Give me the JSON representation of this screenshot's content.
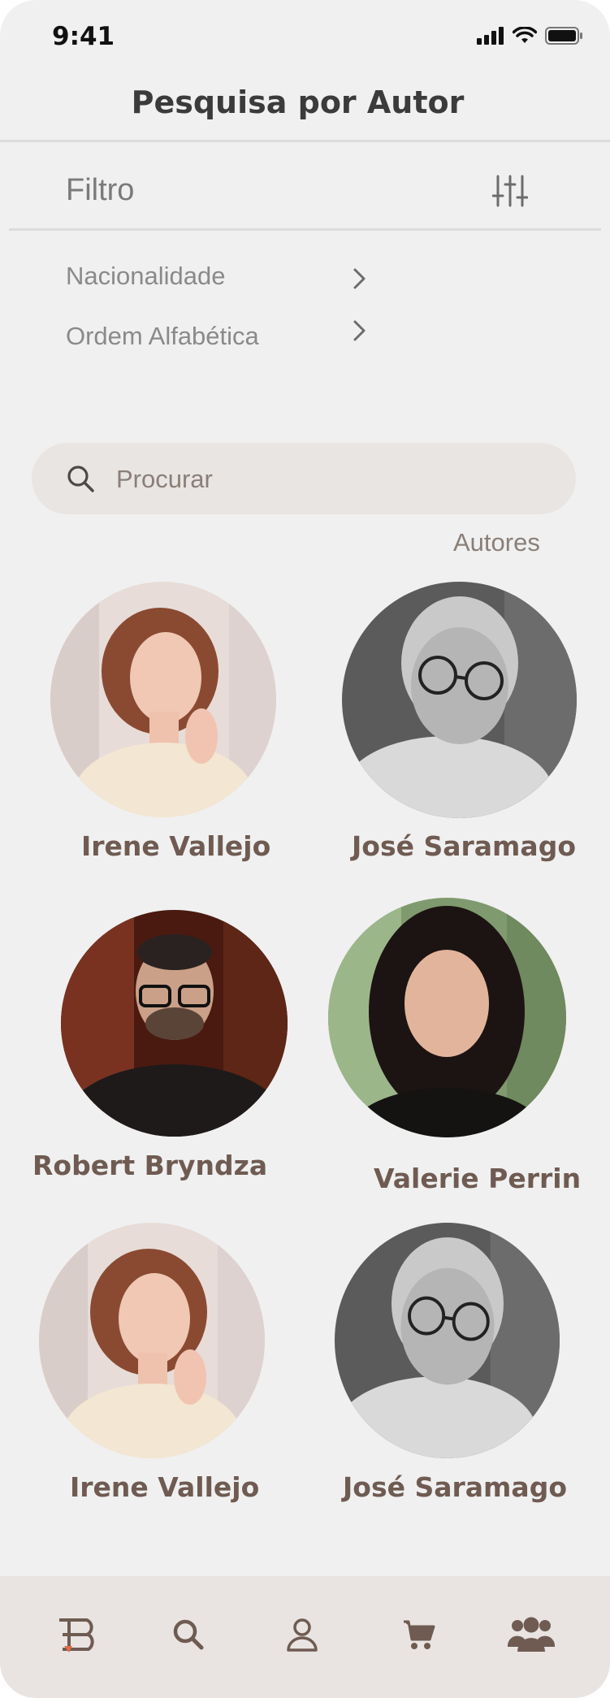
{
  "status_bar": {
    "time": "9:41"
  },
  "header": {
    "title": "Pesquisa por Autor"
  },
  "filter": {
    "label": "Filtro",
    "options": [
      {
        "label": "Nacionalidade"
      },
      {
        "label": "Ordem Alfabética"
      }
    ]
  },
  "search": {
    "placeholder": "Procurar"
  },
  "authors_section": {
    "label": "Autores"
  },
  "authors": [
    {
      "name": "Irene Vallejo"
    },
    {
      "name": "José Saramago"
    },
    {
      "name": "Robert Bryndza"
    },
    {
      "name": "Valerie Perrin"
    },
    {
      "name": "Irene Vallejo"
    },
    {
      "name": "José Saramago"
    }
  ],
  "bottom_nav": {
    "items": [
      {
        "icon": "home-logo-icon"
      },
      {
        "icon": "search-icon"
      },
      {
        "icon": "user-icon"
      },
      {
        "icon": "cart-icon"
      },
      {
        "icon": "authors-group-icon"
      }
    ],
    "accent": "#e36a4a"
  },
  "colors": {
    "text_brown": "#6f5b52",
    "search_bg": "#e9e5e2",
    "nav_bg": "#e9e4e1"
  }
}
